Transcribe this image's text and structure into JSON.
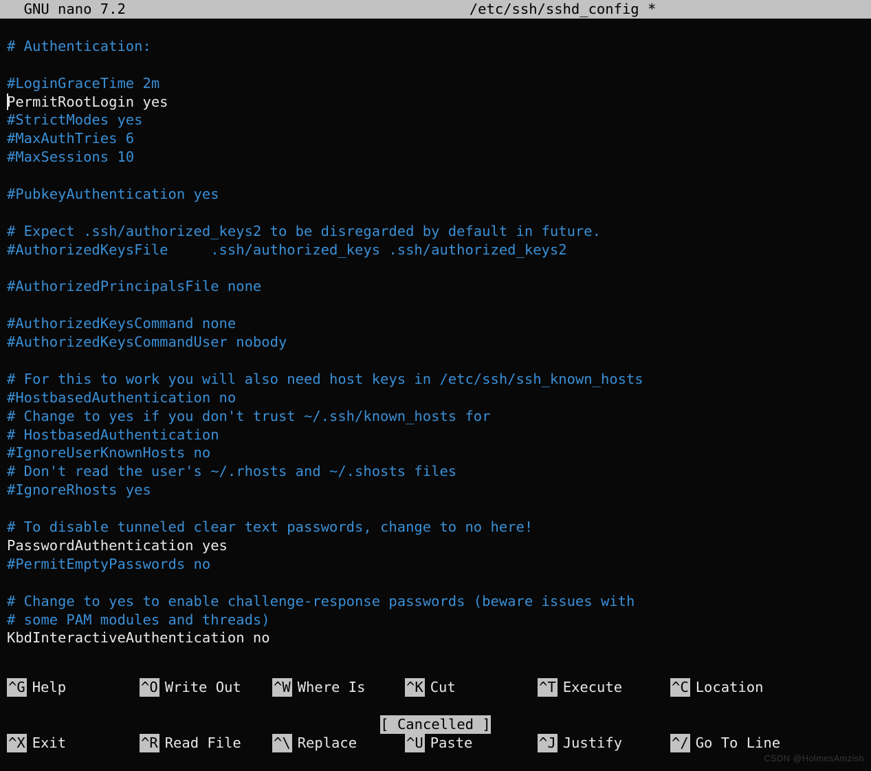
{
  "title": {
    "app": "  GNU nano 7.2",
    "file": "/etc/ssh/sshd_config *"
  },
  "lines": [
    {
      "cls": "blank",
      "text": ""
    },
    {
      "cls": "comment",
      "text": "# Authentication:"
    },
    {
      "cls": "blank",
      "text": ""
    },
    {
      "cls": "comment",
      "text": "#LoginGraceTime 2m"
    },
    {
      "cls": "plain",
      "text": "PermitRootLogin yes",
      "cursor": true
    },
    {
      "cls": "comment",
      "text": "#StrictModes yes"
    },
    {
      "cls": "comment",
      "text": "#MaxAuthTries 6"
    },
    {
      "cls": "comment",
      "text": "#MaxSessions 10"
    },
    {
      "cls": "blank",
      "text": ""
    },
    {
      "cls": "comment",
      "text": "#PubkeyAuthentication yes"
    },
    {
      "cls": "blank",
      "text": ""
    },
    {
      "cls": "comment",
      "text": "# Expect .ssh/authorized_keys2 to be disregarded by default in future."
    },
    {
      "cls": "comment",
      "text": "#AuthorizedKeysFile     .ssh/authorized_keys .ssh/authorized_keys2"
    },
    {
      "cls": "blank",
      "text": ""
    },
    {
      "cls": "comment",
      "text": "#AuthorizedPrincipalsFile none"
    },
    {
      "cls": "blank",
      "text": ""
    },
    {
      "cls": "comment",
      "text": "#AuthorizedKeysCommand none"
    },
    {
      "cls": "comment",
      "text": "#AuthorizedKeysCommandUser nobody"
    },
    {
      "cls": "blank",
      "text": ""
    },
    {
      "cls": "comment",
      "text": "# For this to work you will also need host keys in /etc/ssh/ssh_known_hosts"
    },
    {
      "cls": "comment",
      "text": "#HostbasedAuthentication no"
    },
    {
      "cls": "comment",
      "text": "# Change to yes if you don't trust ~/.ssh/known_hosts for"
    },
    {
      "cls": "comment",
      "text": "# HostbasedAuthentication"
    },
    {
      "cls": "comment",
      "text": "#IgnoreUserKnownHosts no"
    },
    {
      "cls": "comment",
      "text": "# Don't read the user's ~/.rhosts and ~/.shosts files"
    },
    {
      "cls": "comment",
      "text": "#IgnoreRhosts yes"
    },
    {
      "cls": "blank",
      "text": ""
    },
    {
      "cls": "comment",
      "text": "# To disable tunneled clear text passwords, change to no here!"
    },
    {
      "cls": "plain",
      "text": "PasswordAuthentication yes"
    },
    {
      "cls": "comment",
      "text": "#PermitEmptyPasswords no"
    },
    {
      "cls": "blank",
      "text": ""
    },
    {
      "cls": "comment",
      "text": "# Change to yes to enable challenge-response passwords (beware issues with"
    },
    {
      "cls": "comment",
      "text": "# some PAM modules and threads)"
    },
    {
      "cls": "plain",
      "text": "KbdInteractiveAuthentication no"
    }
  ],
  "status": "[ Cancelled ]",
  "shortcuts": {
    "row1": [
      {
        "key": "^G",
        "label": "Help"
      },
      {
        "key": "^O",
        "label": "Write Out"
      },
      {
        "key": "^W",
        "label": "Where Is"
      },
      {
        "key": "^K",
        "label": "Cut"
      },
      {
        "key": "^T",
        "label": "Execute"
      },
      {
        "key": "^C",
        "label": "Location"
      }
    ],
    "row2": [
      {
        "key": "^X",
        "label": "Exit"
      },
      {
        "key": "^R",
        "label": "Read File"
      },
      {
        "key": "^\\",
        "label": "Replace"
      },
      {
        "key": "^U",
        "label": "Paste"
      },
      {
        "key": "^J",
        "label": "Justify"
      },
      {
        "key": "^/",
        "label": "Go To Line"
      }
    ]
  },
  "watermark": "CSDN @HolmesAmzish"
}
